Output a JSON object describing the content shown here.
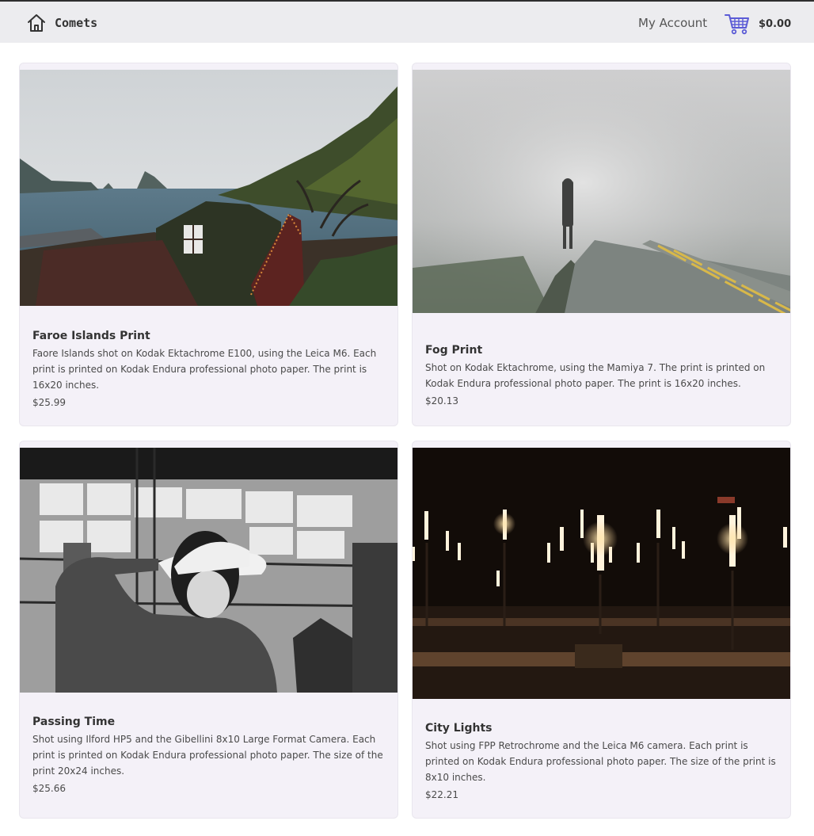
{
  "header": {
    "brand": "Comets",
    "account_link": "My Account",
    "cart_total": "$0.00",
    "icons": {
      "home": "home-icon",
      "cart": "shopping-cart-icon"
    },
    "accent_color": "#5b5bd6"
  },
  "products": [
    {
      "title": "Faroe Islands Print",
      "description": "Faore Islands shot on Kodak Ektachrome E100, using the Leica M6. Each print is printed on Kodak Endura professional photo paper. The print is 16x20 inches.",
      "price": "$25.99"
    },
    {
      "title": "Fog Print",
      "description": "Shot on Kodak Ektachrome, using the Mamiya 7. The print is printed on Kodak Endura professional photo paper. The print is 16x20 inches.",
      "price": "$20.13"
    },
    {
      "title": "Passing Time",
      "description": "Shot using Ilford HP5 and the Gibellini 8x10 Large Format Camera. Each print is printed on Kodak Endura professional photo paper. The size of the print 20x24 inches.",
      "price": "$25.66"
    },
    {
      "title": "City Lights",
      "description": "Shot using FPP Retrochrome and the Leica M6 camera. Each print is printed on Kodak Endura professional photo paper. The size of the print is 8x10 inches.",
      "price": "$22.21"
    }
  ]
}
